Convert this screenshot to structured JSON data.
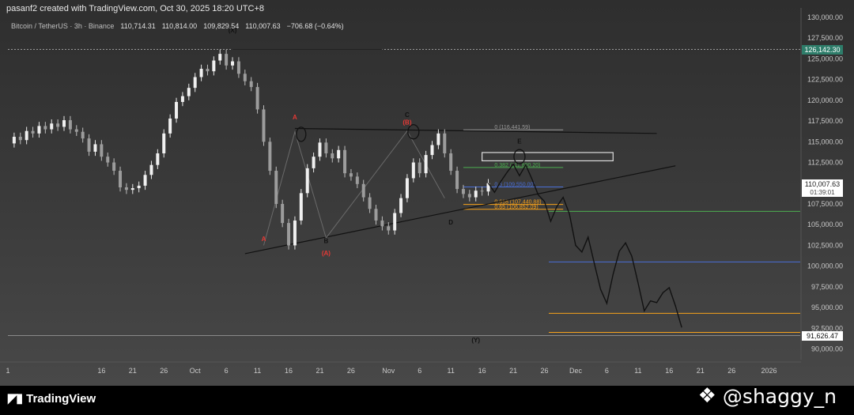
{
  "header": {
    "created_line": "pasanf2 created with TradingView.com, Oct 30, 2025 18:20 UTC+8"
  },
  "symbol": {
    "name": "Bitcoin / TetherUS · 3h · Binance",
    "open": "110,714.31",
    "high": "110,814.00",
    "low": "109,829.54",
    "close": "110,007.63",
    "change": "−706.68 (−0.64%)"
  },
  "price_badges": {
    "top": "126,142.30",
    "current": "110,007.63",
    "countdown": "01:39:01",
    "bottom": "91,626.47"
  },
  "footer": {
    "brand": "TradingView",
    "signature": "@shaggy_n",
    "brand_icon": "tradingview-logo-icon",
    "signature_icon": "binance-diamond-icon"
  },
  "colors": {
    "background": "#3a3a3a",
    "green_line": "#4caf50",
    "blue_line": "#4a6fd8",
    "orange_line": "#f7a21b",
    "red_label": "#e53935",
    "badge_current": "#ffffff",
    "badge_top": "#2e7d6a"
  },
  "chart_data": {
    "type": "line",
    "title": "",
    "xlabel": "",
    "ylabel": "",
    "ylim": [
      89000,
      130000
    ],
    "y_ticks": [
      {
        "value": 130000,
        "label": "130,000.00"
      },
      {
        "value": 127500,
        "label": "127,500.00"
      },
      {
        "value": 125000,
        "label": "125,000.00"
      },
      {
        "value": 122500,
        "label": "122,500.00"
      },
      {
        "value": 120000,
        "label": "120,000.00"
      },
      {
        "value": 117500,
        "label": "117,500.00"
      },
      {
        "value": 115000,
        "label": "115,000.00"
      },
      {
        "value": 112500,
        "label": "112,500.00"
      },
      {
        "value": 107500,
        "label": "107,500.00"
      },
      {
        "value": 105000,
        "label": "105,000.00"
      },
      {
        "value": 102500,
        "label": "102,500.00"
      },
      {
        "value": 100000,
        "label": "100,000.00"
      },
      {
        "value": 97500,
        "label": "97,500.00"
      },
      {
        "value": 95000,
        "label": "95,000.00"
      },
      {
        "value": 92500,
        "label": "92,500.00"
      },
      {
        "value": 90000,
        "label": "90,000.00"
      }
    ],
    "x_ticks": [
      {
        "day": 1,
        "label": "1"
      },
      {
        "day": 16,
        "label": "16"
      },
      {
        "day": 21,
        "label": "21"
      },
      {
        "day": 26,
        "label": "26"
      },
      {
        "day": 31,
        "label": "Oct"
      },
      {
        "day": 36,
        "label": "6"
      },
      {
        "day": 41,
        "label": "11"
      },
      {
        "day": 46,
        "label": "16"
      },
      {
        "day": 51,
        "label": "21"
      },
      {
        "day": 56,
        "label": "26"
      },
      {
        "day": 62,
        "label": "Nov"
      },
      {
        "day": 67,
        "label": "6"
      },
      {
        "day": 72,
        "label": "11"
      },
      {
        "day": 77,
        "label": "16"
      },
      {
        "day": 82,
        "label": "21"
      },
      {
        "day": 87,
        "label": "26"
      },
      {
        "day": 92,
        "label": "Dec"
      },
      {
        "day": 97,
        "label": "6"
      },
      {
        "day": 102,
        "label": "11"
      },
      {
        "day": 107,
        "label": "16"
      },
      {
        "day": 112,
        "label": "21"
      },
      {
        "day": 117,
        "label": "26"
      },
      {
        "day": 123,
        "label": "2026"
      }
    ],
    "series": [
      {
        "name": "",
        "kind": "price",
        "points": [
          [
            1,
            114800
          ],
          [
            2,
            115600
          ],
          [
            3,
            115200
          ],
          [
            4,
            116300
          ],
          [
            5,
            116000
          ],
          [
            6,
            116900
          ],
          [
            7,
            116500
          ],
          [
            8,
            117200
          ],
          [
            9,
            116800
          ],
          [
            10,
            117600
          ],
          [
            11,
            116500
          ],
          [
            12,
            116200
          ],
          [
            13,
            115400
          ],
          [
            14,
            113800
          ],
          [
            15,
            114700
          ],
          [
            16,
            113200
          ],
          [
            17,
            112500
          ],
          [
            18,
            111500
          ],
          [
            19,
            109500
          ],
          [
            20,
            109200
          ],
          [
            21,
            109400
          ],
          [
            22,
            109700
          ],
          [
            23,
            111000
          ],
          [
            24,
            112200
          ],
          [
            25,
            113600
          ],
          [
            26,
            116000
          ],
          [
            27,
            117800
          ],
          [
            28,
            119800
          ],
          [
            29,
            120500
          ],
          [
            30,
            121500
          ],
          [
            31,
            122800
          ],
          [
            32,
            123800
          ],
          [
            33,
            123500
          ],
          [
            34,
            124800
          ],
          [
            35,
            125600
          ],
          [
            36,
            124200
          ],
          [
            37,
            124700
          ],
          [
            38,
            123200
          ],
          [
            39,
            122300
          ],
          [
            40,
            121600
          ],
          [
            41,
            118900
          ],
          [
            42,
            115000
          ],
          [
            43,
            111500
          ],
          [
            44,
            107500
          ],
          [
            45,
            105200
          ],
          [
            46,
            102500
          ],
          [
            47,
            105500
          ],
          [
            48,
            108800
          ],
          [
            49,
            111800
          ],
          [
            50,
            113200
          ],
          [
            51,
            114900
          ],
          [
            52,
            113600
          ],
          [
            53,
            113000
          ],
          [
            54,
            114000
          ],
          [
            55,
            111200
          ],
          [
            56,
            110800
          ],
          [
            57,
            109900
          ],
          [
            58,
            108300
          ],
          [
            59,
            106900
          ],
          [
            60,
            105500
          ],
          [
            61,
            104800
          ],
          [
            62,
            104300
          ],
          [
            63,
            106400
          ],
          [
            64,
            108200
          ],
          [
            65,
            110600
          ],
          [
            66,
            112500
          ],
          [
            67,
            111200
          ],
          [
            68,
            113400
          ],
          [
            69,
            114600
          ],
          [
            70,
            116000
          ],
          [
            71,
            113600
          ],
          [
            72,
            111500
          ],
          [
            73,
            109300
          ],
          [
            74,
            108700
          ],
          [
            75,
            108300
          ],
          [
            76,
            109100
          ],
          [
            77,
            109000
          ],
          [
            78,
            110000
          ]
        ]
      },
      {
        "name": "",
        "kind": "projection",
        "points": [
          [
            78,
            110000
          ],
          [
            79,
            108900
          ],
          [
            80,
            110200
          ],
          [
            81,
            111300
          ],
          [
            82,
            112300
          ],
          [
            83,
            110900
          ],
          [
            84,
            112200
          ],
          [
            85,
            110500
          ],
          [
            86,
            108600
          ],
          [
            87,
            107800
          ],
          [
            88,
            105400
          ],
          [
            89,
            107200
          ],
          [
            90,
            108300
          ],
          [
            91,
            106300
          ],
          [
            92,
            102500
          ],
          [
            93,
            101700
          ],
          [
            94,
            103500
          ],
          [
            95,
            100300
          ],
          [
            96,
            97200
          ],
          [
            97,
            95500
          ],
          [
            98,
            99000
          ],
          [
            99,
            101800
          ],
          [
            100,
            102800
          ],
          [
            101,
            101200
          ],
          [
            102,
            98000
          ],
          [
            103,
            94600
          ],
          [
            104,
            95800
          ],
          [
            105,
            95600
          ],
          [
            106,
            96800
          ],
          [
            107,
            97400
          ],
          [
            108,
            95200
          ],
          [
            109,
            92600
          ]
        ]
      }
    ],
    "horizontal_levels": [
      {
        "label": "0 (116,441.59)",
        "value": 116441.59
      },
      {
        "label": "0.382 (111,890.20)",
        "value": 111890.2
      },
      {
        "label": "0.5 (109,550.00)",
        "value": 109550.0
      },
      {
        "label": "0.618 (107,440.88)",
        "value": 107440.88
      },
      {
        "label": "0.65 (106,852.09)",
        "value": 106852.09
      }
    ],
    "wave_labels": [
      {
        "text": "(X)",
        "x": 37,
        "y": 128200
      },
      {
        "text": "A",
        "x": 42,
        "y": 103000
      },
      {
        "text": "A",
        "x": 47,
        "y": 117700
      },
      {
        "text": "B",
        "x": 52,
        "y": 102800
      },
      {
        "text": "(A)",
        "x": 52,
        "y": 101300
      },
      {
        "text": "C",
        "x": 65,
        "y": 118000
      },
      {
        "text": "(B)",
        "x": 65,
        "y": 117100
      },
      {
        "text": "D",
        "x": 72,
        "y": 105000
      },
      {
        "text": "E",
        "x": 83,
        "y": 114800
      },
      {
        "text": "(Y)",
        "x": 76,
        "y": 90800
      }
    ]
  }
}
